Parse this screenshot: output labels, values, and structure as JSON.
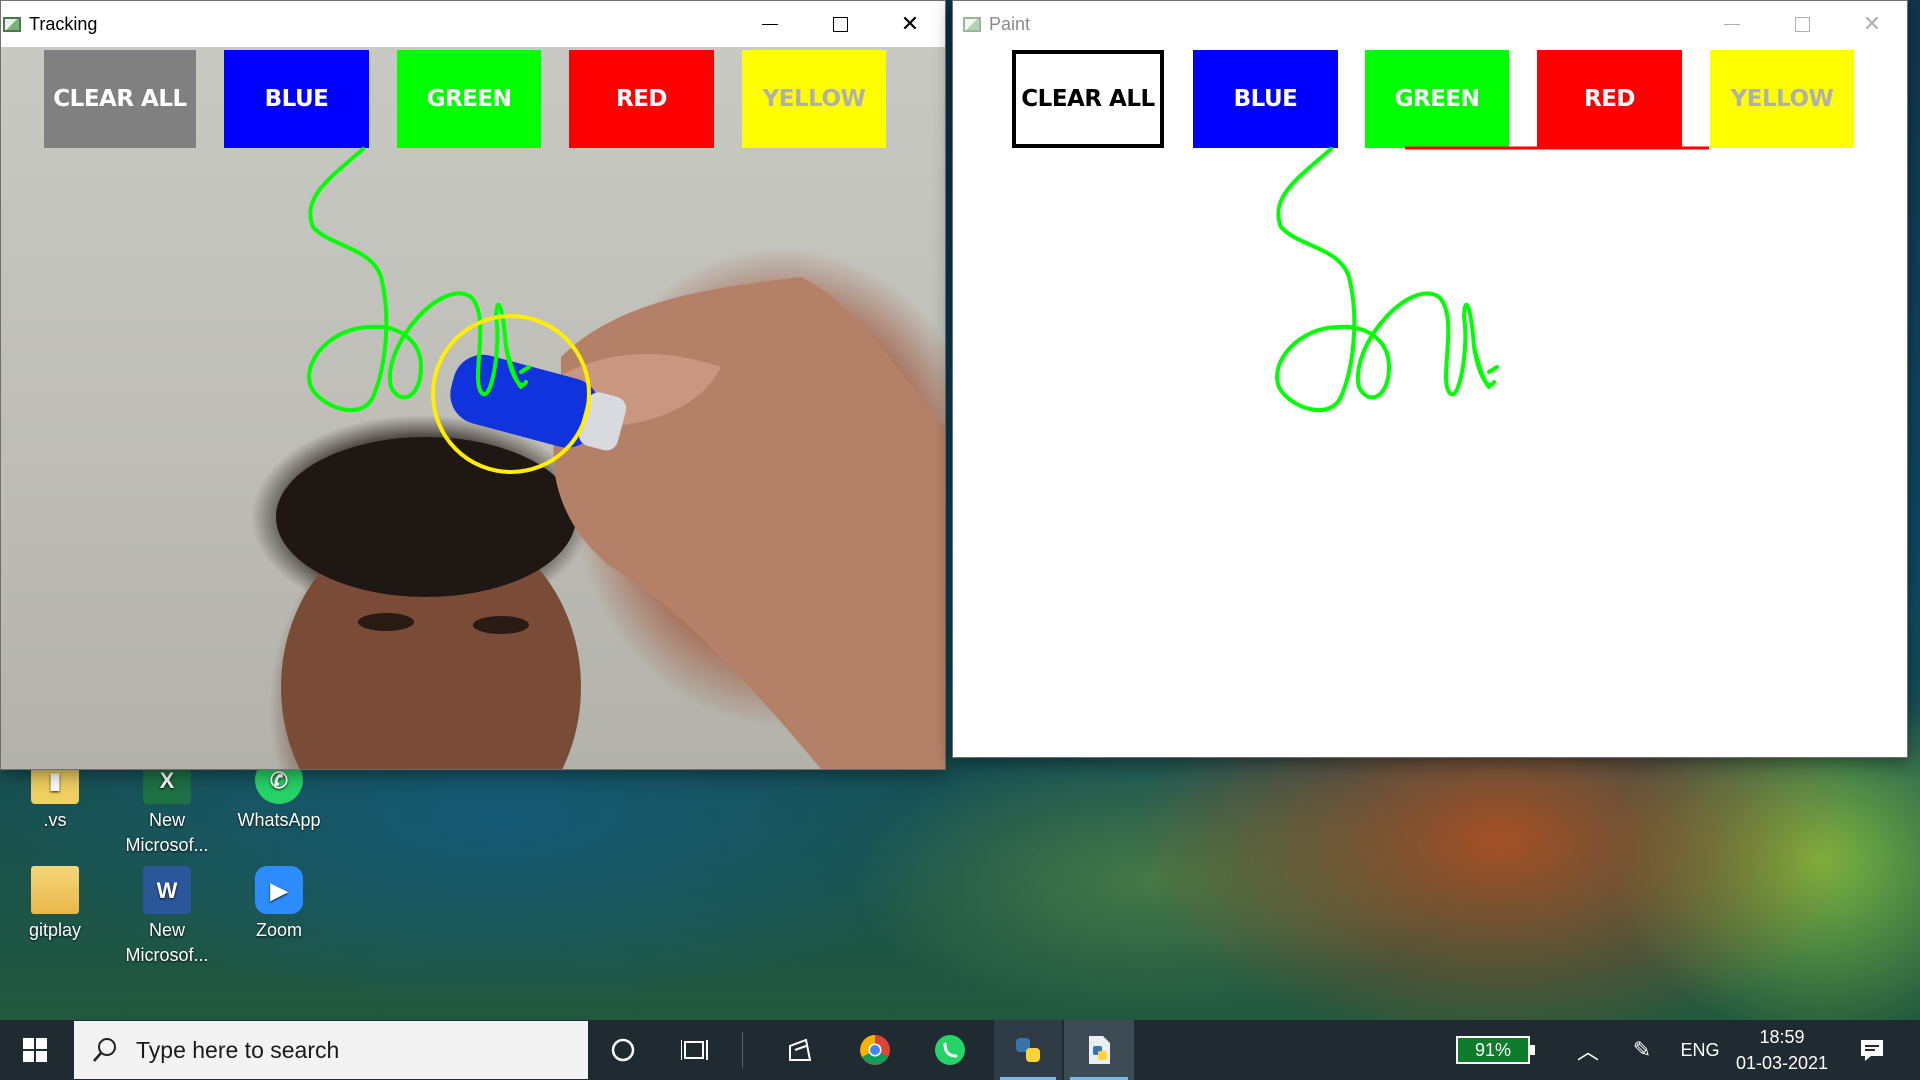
{
  "desktop": {
    "icons": [
      {
        "label": ".vs",
        "icon": "vs-folder-icon"
      },
      {
        "label": "New Microsof...",
        "icon": "excel-icon"
      },
      {
        "label": "WhatsApp",
        "icon": "whatsapp-icon"
      },
      {
        "label": "gitplay",
        "icon": "folder-icon"
      },
      {
        "label": "New Microsof...",
        "icon": "word-icon"
      },
      {
        "label": "Zoom",
        "icon": "zoom-icon"
      }
    ]
  },
  "tracking_window": {
    "title": "Tracking",
    "buttons": {
      "clear": "CLEAR ALL",
      "blue": "BLUE",
      "green": "GREEN",
      "red": "RED",
      "yellow": "YELLOW"
    }
  },
  "paint_window": {
    "title": "Paint",
    "buttons": {
      "clear": "CLEAR ALL",
      "blue": "BLUE",
      "green": "GREEN",
      "red": "RED",
      "yellow": "YELLOW"
    }
  },
  "colors": {
    "stroke": "#00ff00",
    "tracker_ring": "#ffee00",
    "marker": "#1133dd"
  },
  "taskbar": {
    "search_placeholder": "Type here to search",
    "battery": "91%",
    "language": "ENG",
    "time": "18:59",
    "date": "01-03-2021"
  }
}
